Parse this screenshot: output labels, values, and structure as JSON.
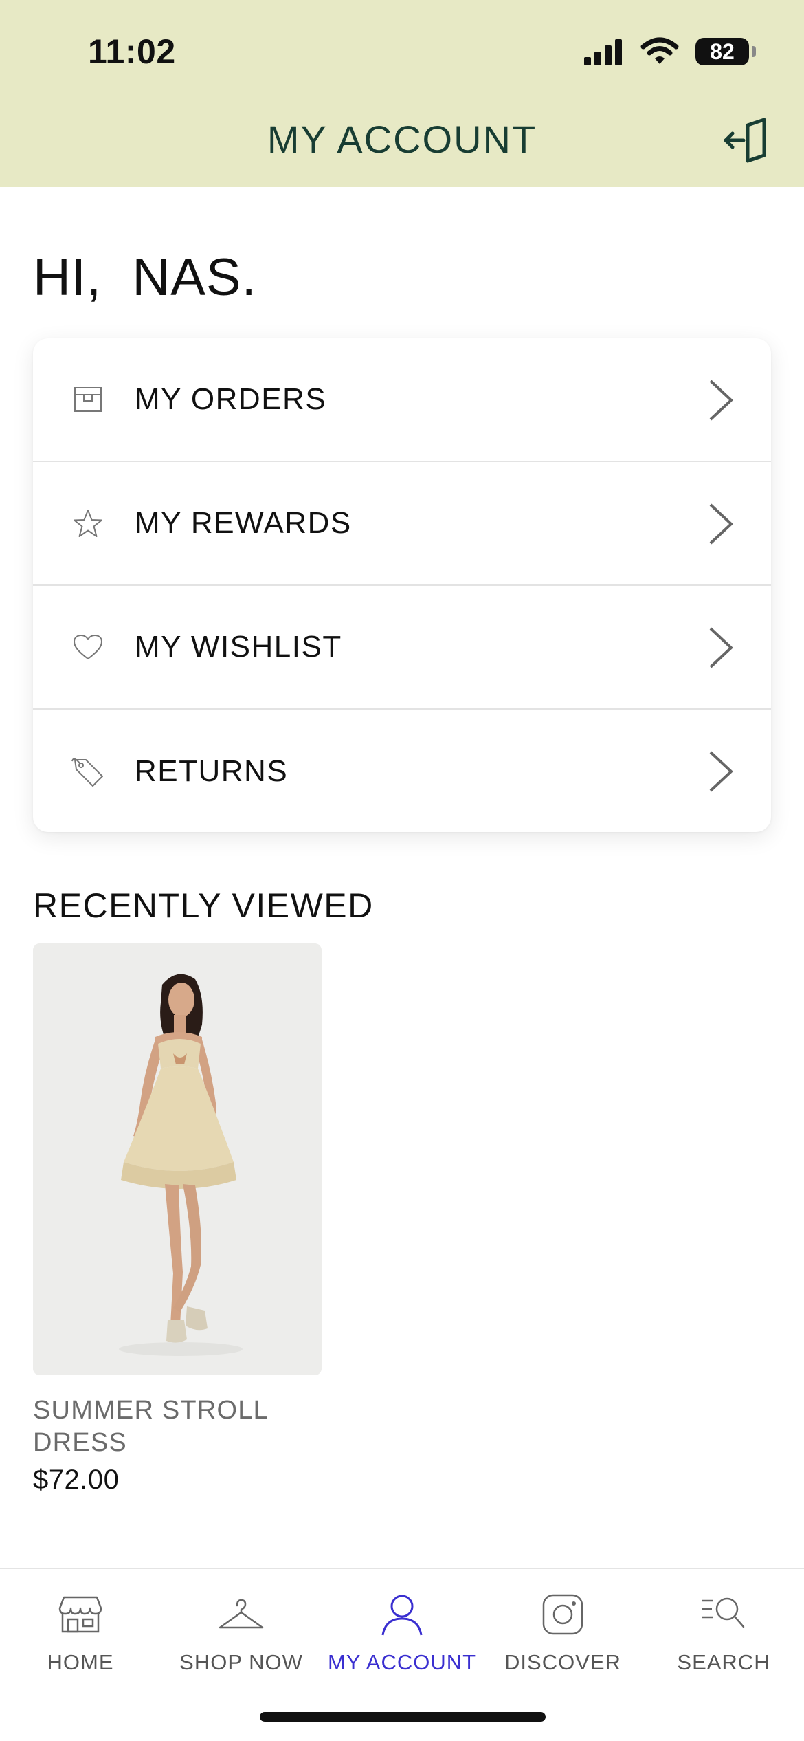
{
  "status_bar": {
    "time": "11:02",
    "battery": "82"
  },
  "header": {
    "title": "MY ACCOUNT"
  },
  "greeting": "HI,  NAS.",
  "menu": [
    {
      "label": "MY ORDERS",
      "icon": "box-icon"
    },
    {
      "label": "MY REWARDS",
      "icon": "star-icon"
    },
    {
      "label": "MY WISHLIST",
      "icon": "heart-icon"
    },
    {
      "label": "RETURNS",
      "icon": "tag-icon"
    }
  ],
  "recently_viewed": {
    "title": "RECENTLY VIEWED",
    "items": [
      {
        "name": "SUMMER STROLL DRESS",
        "price": "$72.00"
      }
    ]
  },
  "tabs": [
    {
      "label": "HOME",
      "icon": "storefront-icon",
      "active": false
    },
    {
      "label": "SHOP NOW",
      "icon": "hanger-icon",
      "active": false
    },
    {
      "label": "MY ACCOUNT",
      "icon": "person-icon",
      "active": true
    },
    {
      "label": "DISCOVER",
      "icon": "instagram-icon",
      "active": false
    },
    {
      "label": "SEARCH",
      "icon": "search-icon",
      "active": false
    }
  ],
  "colors": {
    "header_bg": "#e7e9c5",
    "header_text": "#183d33",
    "active_tab": "#3a2fd0"
  }
}
